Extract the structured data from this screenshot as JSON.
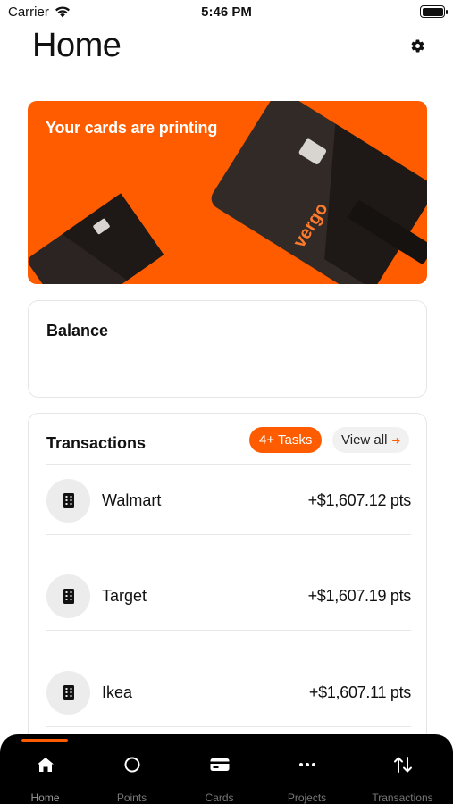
{
  "status_bar": {
    "carrier": "Carrier",
    "time": "5:46 PM"
  },
  "header": {
    "title": "Home",
    "settings_icon": "gear-icon"
  },
  "promo": {
    "text": "Your cards are printing",
    "card_brand": "vergo",
    "background_color": "#ff5c00"
  },
  "balance": {
    "title": "Balance"
  },
  "transactions": {
    "title": "Transactions",
    "tasks_badge": "4+ Tasks",
    "view_all": "View all",
    "items": [
      {
        "name": "Walmart",
        "amount": "+$1,607.12 pts",
        "icon": "building-icon"
      },
      {
        "name": "Target",
        "amount": "+$1,607.19 pts",
        "icon": "building-icon"
      },
      {
        "name": "Ikea",
        "amount": "+$1,607.11 pts",
        "icon": "building-icon"
      }
    ]
  },
  "tab_bar": {
    "active": "Home",
    "accent_color": "#ff5c00",
    "tabs": [
      {
        "label": "Home",
        "icon": "home-icon"
      },
      {
        "label": "Points",
        "icon": "circle-icon"
      },
      {
        "label": "Cards",
        "icon": "card-icon"
      },
      {
        "label": "Projects",
        "icon": "ellipsis-icon"
      },
      {
        "label": "Transactions",
        "icon": "swap-arrows-icon"
      }
    ]
  }
}
